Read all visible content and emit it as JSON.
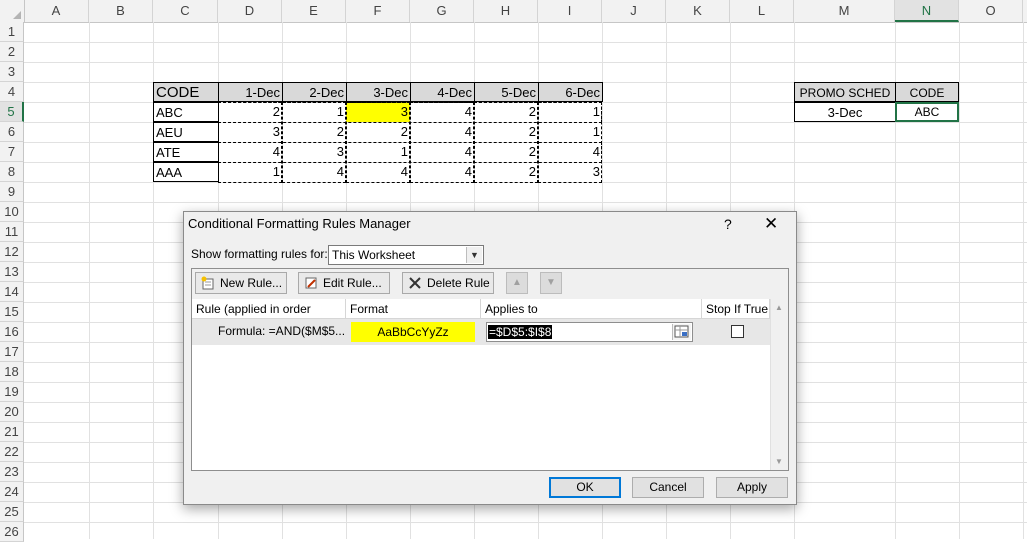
{
  "spreadsheet": {
    "columns": [
      "A",
      "B",
      "C",
      "D",
      "E",
      "F",
      "G",
      "H",
      "I",
      "J",
      "K",
      "L",
      "M",
      "N",
      "O"
    ],
    "selected_column": "N",
    "rows": [
      "1",
      "2",
      "3",
      "4",
      "5",
      "6",
      "7",
      "8",
      "9",
      "10",
      "11",
      "12",
      "13",
      "14",
      "15",
      "16",
      "17",
      "18",
      "19",
      "20",
      "21",
      "22",
      "23",
      "24",
      "25",
      "26"
    ],
    "selected_row": "5",
    "table": {
      "header": [
        "CODE",
        "1-Dec",
        "2-Dec",
        "3-Dec",
        "4-Dec",
        "5-Dec",
        "6-Dec"
      ],
      "rows": [
        [
          "ABC",
          "2",
          "1",
          "3",
          "4",
          "2",
          "1"
        ],
        [
          "AEU",
          "3",
          "2",
          "2",
          "4",
          "2",
          "1"
        ],
        [
          "ATE",
          "4",
          "3",
          "1",
          "4",
          "2",
          "4"
        ],
        [
          "AAA",
          "1",
          "4",
          "4",
          "4",
          "2",
          "3"
        ]
      ],
      "highlight_color": "#ffff00"
    },
    "promo": {
      "header": [
        "PROMO SCHED",
        "CODE"
      ],
      "values": [
        "3-Dec",
        "ABC"
      ]
    }
  },
  "dialog": {
    "title": "Conditional Formatting Rules Manager",
    "help": "?",
    "close": "✕",
    "show_for_label": "Show formatting rules for:",
    "show_for_value": "This Worksheet",
    "buttons": {
      "new_rule": "New Rule...",
      "edit_rule": "Edit Rule...",
      "delete_rule": "Delete Rule",
      "move_up": "▲",
      "move_down": "▼"
    },
    "columns": [
      "Rule (applied in order shown)",
      "Format",
      "Applies to",
      "Stop If True"
    ],
    "rule": {
      "text": "Formula: =AND($M$5...",
      "format_preview": "AaBbCcYyZz",
      "applies_to": "=$D$5:$I$8",
      "stop_if_true": false
    },
    "footer": {
      "ok": "OK",
      "cancel": "Cancel",
      "apply": "Apply"
    }
  },
  "colors": {
    "accent": "#217346",
    "preview_fill": "#ffff00",
    "default_button": "#0078d7"
  }
}
